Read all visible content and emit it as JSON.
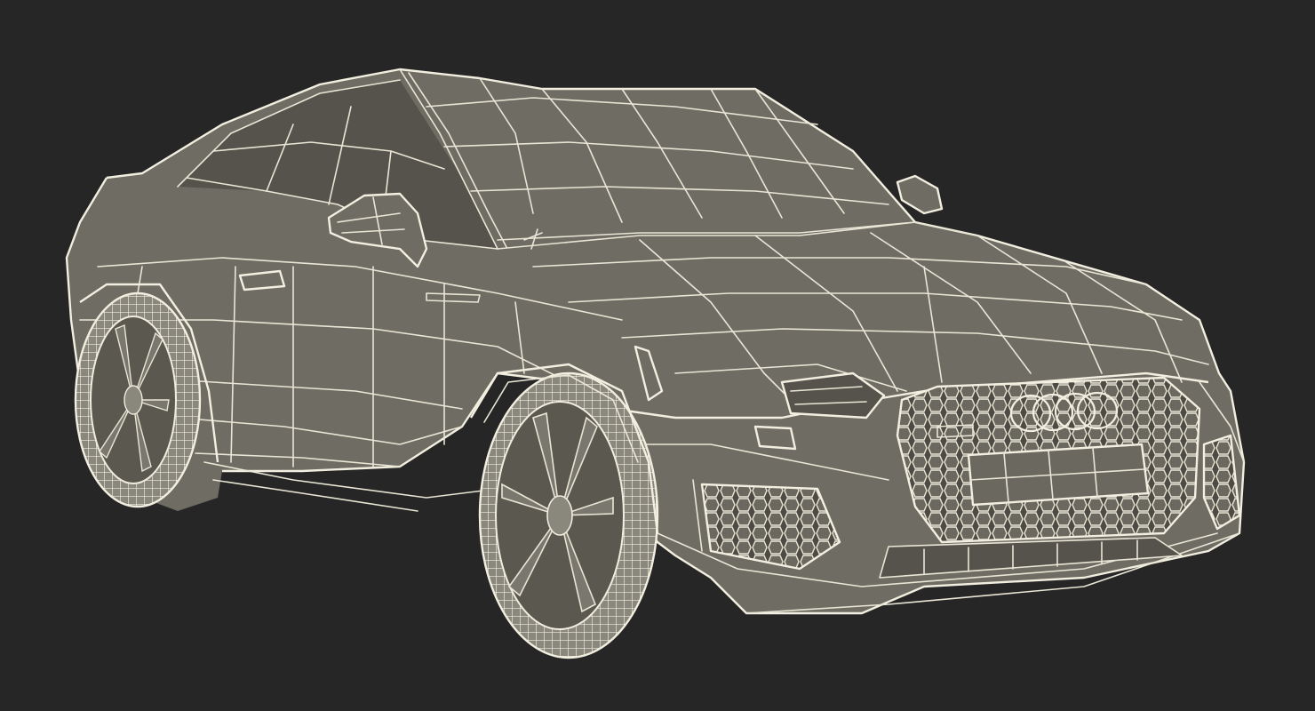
{
  "scene": {
    "background_color": "#262626",
    "subject": "car-wireframe-render",
    "wire_color": "#e9e6d6",
    "surface_color": "#6e6c63"
  }
}
